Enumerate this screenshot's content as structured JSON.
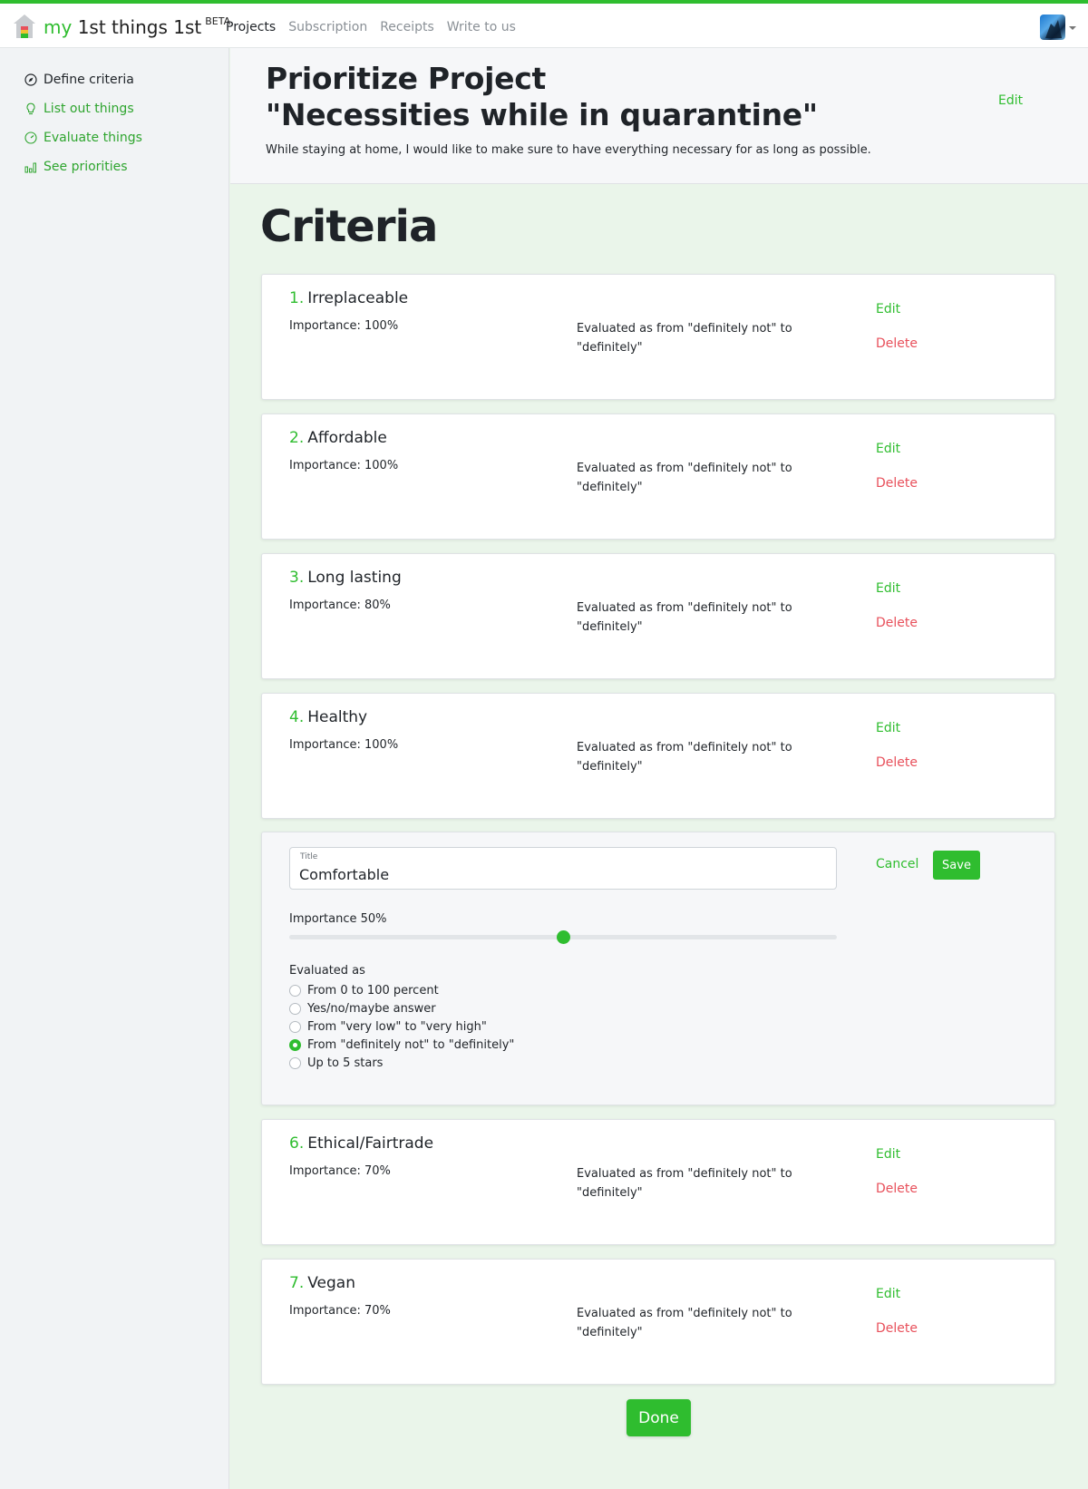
{
  "app": {
    "brand_prefix": "my",
    "brand_main": "1st things 1st",
    "brand_badge": "BETA",
    "logo_icon": "house-icon",
    "avatar": "user-avatar"
  },
  "nav": [
    {
      "label": "Projects",
      "active": true
    },
    {
      "label": "Subscription",
      "active": false
    },
    {
      "label": "Receipts",
      "active": false
    },
    {
      "label": "Write to us",
      "active": false
    }
  ],
  "sidebar": {
    "items": [
      {
        "label": "Define criteria",
        "icon": "compass-icon",
        "active": true
      },
      {
        "label": "List out things",
        "icon": "lightbulb-icon",
        "active": false
      },
      {
        "label": "Evaluate things",
        "icon": "gauge-icon",
        "active": false
      },
      {
        "label": "See priorities",
        "icon": "bar-chart-icon",
        "active": false
      }
    ]
  },
  "project": {
    "title_line1": "Prioritize Project",
    "title_line2": "\"Necessities while in quarantine\"",
    "description": "While staying at home, I would like to make sure to have everything necessary for as long as possible.",
    "edit_label": "Edit"
  },
  "section_title": "Criteria",
  "criteria": [
    {
      "num": "1.",
      "title": "Irreplaceable",
      "importance": "Importance: 100%",
      "evaluated": "Evaluated as from \"definitely not\" to \"definitely\"",
      "edit": "Edit",
      "delete": "Delete"
    },
    {
      "num": "2.",
      "title": "Affordable",
      "importance": "Importance: 100%",
      "evaluated": "Evaluated as from \"definitely not\" to \"definitely\"",
      "edit": "Edit",
      "delete": "Delete"
    },
    {
      "num": "3.",
      "title": "Long lasting",
      "importance": "Importance: 80%",
      "evaluated": "Evaluated as from \"definitely not\" to \"definitely\"",
      "edit": "Edit",
      "delete": "Delete"
    },
    {
      "num": "4.",
      "title": "Healthy",
      "importance": "Importance: 100%",
      "evaluated": "Evaluated as from \"definitely not\" to \"definitely\"",
      "edit": "Edit",
      "delete": "Delete"
    },
    {
      "num": "6.",
      "title": "Ethical/Fairtrade",
      "importance": "Importance: 70%",
      "evaluated": "Evaluated as from \"definitely not\" to \"definitely\"",
      "edit": "Edit",
      "delete": "Delete"
    },
    {
      "num": "7.",
      "title": "Vegan",
      "importance": "Importance: 70%",
      "evaluated": "Evaluated as from \"definitely not\" to \"definitely\"",
      "edit": "Edit",
      "delete": "Delete"
    }
  ],
  "editor": {
    "field_label": "Title",
    "title_value": "Comfortable",
    "importance_label": "Importance 50%",
    "importance_value": 50,
    "evaluated_label": "Evaluated as",
    "options": [
      {
        "label": "From 0 to 100 percent",
        "checked": false
      },
      {
        "label": "Yes/no/maybe answer",
        "checked": false
      },
      {
        "label": "From \"very low\" to \"very high\"",
        "checked": false
      },
      {
        "label": "From \"definitely not\" to \"definitely\"",
        "checked": true
      },
      {
        "label": "Up to 5 stars",
        "checked": false
      }
    ],
    "cancel_label": "Cancel",
    "save_label": "Save"
  },
  "done_label": "Done",
  "colors": {
    "accent": "#2fbd2f",
    "danger": "#e8505b",
    "page_bg": "#eaf5ea"
  }
}
